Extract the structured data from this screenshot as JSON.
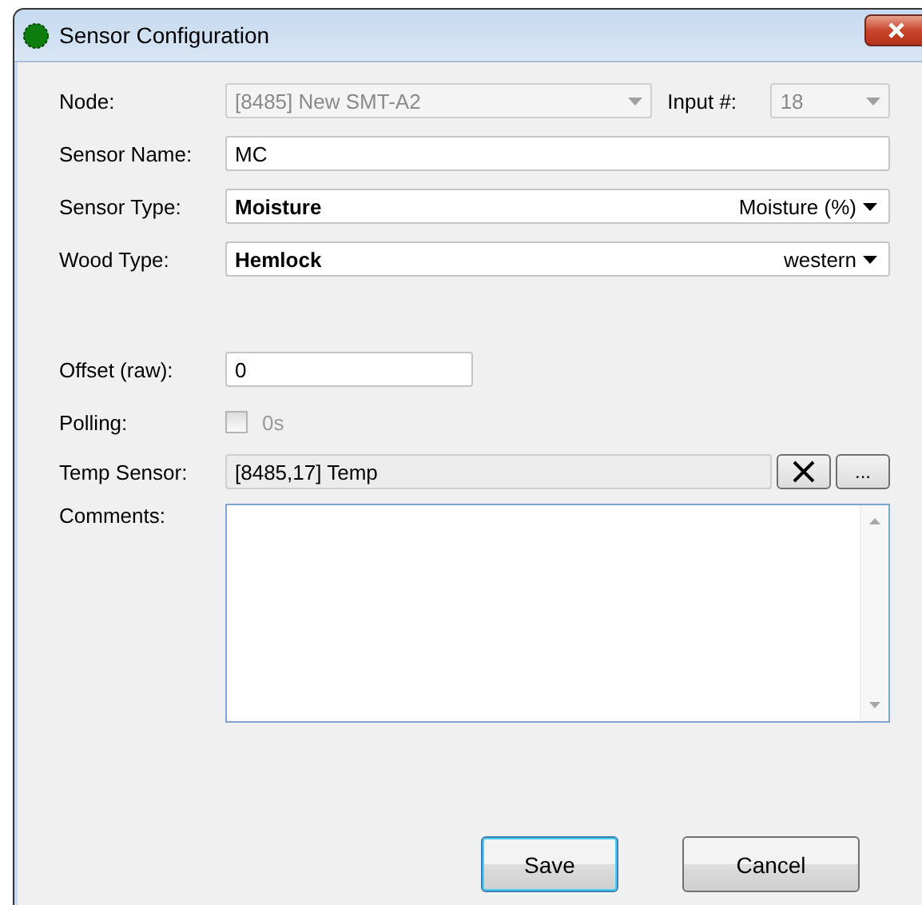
{
  "window": {
    "title": "Sensor Configuration"
  },
  "node": {
    "label": "Node:",
    "value": "[8485] New SMT-A2",
    "disabled": true
  },
  "input": {
    "label": "Input #:",
    "value": "18",
    "disabled": true
  },
  "sensor_name": {
    "label": "Sensor Name:",
    "value": "MC"
  },
  "sensor_type": {
    "label": "Sensor Type:",
    "value": "Moisture",
    "detail": "Moisture (%)"
  },
  "wood_type": {
    "label": "Wood Type:",
    "value": "Hemlock",
    "detail": "western"
  },
  "offset": {
    "label": "Offset (raw):",
    "value": "0"
  },
  "polling": {
    "label": "Polling:",
    "checked": false,
    "disabled": true,
    "value": "0s"
  },
  "temp_sensor": {
    "label": "Temp Sensor:",
    "value": "[8485,17] Temp",
    "buttons": [
      {
        "kind": "clear"
      },
      {
        "kind": "browse",
        "label": "..."
      }
    ]
  },
  "comments": {
    "label": "Comments:"
  },
  "buttons": [
    {
      "label": "Save",
      "default": true
    },
    {
      "label": "Cancel",
      "default": false
    }
  ]
}
